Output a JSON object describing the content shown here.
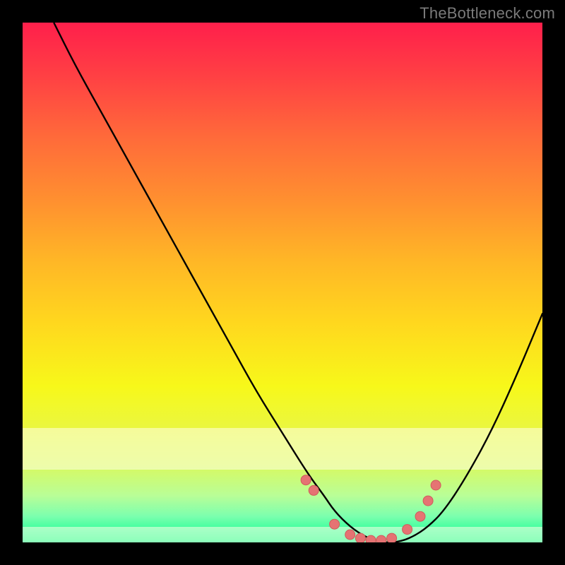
{
  "watermark": "TheBottleneck.com",
  "colors": {
    "background": "#000000",
    "gradient_top": "#ff1f4b",
    "gradient_bottom": "#00ff86",
    "curve": "#000000",
    "marker_fill": "#e57373",
    "marker_stroke": "#cf5b5b",
    "pale_band": "rgba(255,255,230,0.55)",
    "watermark": "#7a7a7a"
  },
  "chart_data": {
    "type": "line",
    "title": "",
    "xlabel": "",
    "ylabel": "",
    "xlim": [
      0,
      100
    ],
    "ylim": [
      0,
      100
    ],
    "series": [
      {
        "name": "bottleneck-curve",
        "x": [
          6,
          10,
          15,
          20,
          25,
          30,
          35,
          40,
          45,
          50,
          55,
          58,
          60,
          63,
          66,
          69,
          72,
          75,
          78,
          81,
          85,
          90,
          95,
          100
        ],
        "y": [
          100,
          92,
          83,
          74,
          65,
          56,
          47,
          38,
          29,
          21,
          13,
          9,
          6,
          3,
          1,
          0,
          0,
          1,
          3,
          6,
          12,
          21,
          32,
          44
        ]
      }
    ],
    "markers": {
      "name": "highlighted-points",
      "x": [
        54.5,
        56,
        60,
        63,
        65,
        67,
        69,
        71,
        74,
        76.5,
        78,
        79.5
      ],
      "y": [
        12,
        10,
        3.5,
        1.5,
        0.8,
        0.4,
        0.4,
        0.8,
        2.5,
        5,
        8,
        11
      ]
    },
    "pale_bands_y": [
      [
        14,
        22
      ],
      [
        0,
        3
      ]
    ]
  }
}
